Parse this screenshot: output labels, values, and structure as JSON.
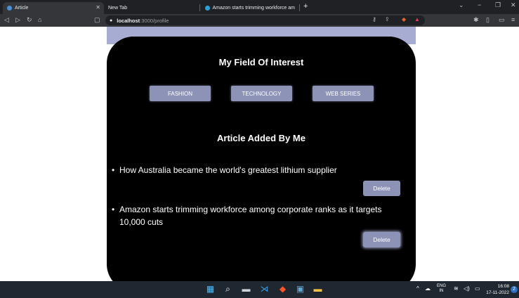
{
  "browser": {
    "tabs": [
      {
        "title": "Article",
        "active": true
      },
      {
        "title": "New Tab",
        "active": false
      },
      {
        "title": "Amazon starts trimming workforce am",
        "active": false
      }
    ],
    "new_tab_symbol": "+",
    "address": {
      "host": "localhost",
      "path": ":3000/profile"
    }
  },
  "page": {
    "interests_heading": "My Field Of Interest",
    "interests": [
      "FASHION",
      "TECHNOLOGY",
      "WEB SERIES"
    ],
    "articles_heading": "Article Added By Me",
    "articles": [
      {
        "title": "How Australia became the world's greatest lithium supplier",
        "delete_label": "Delete"
      },
      {
        "title": "Amazon starts trimming workforce among corporate ranks as it targets 10,000 cuts",
        "delete_label": "Delete"
      }
    ],
    "colors": {
      "card": "#000000",
      "accent": "#8d93b6",
      "strip": "#a7acd2"
    }
  },
  "taskbar": {
    "lang": "ENG",
    "region": "IN",
    "time": "16:08",
    "date": "17-11-2022",
    "notification_count": "2"
  }
}
